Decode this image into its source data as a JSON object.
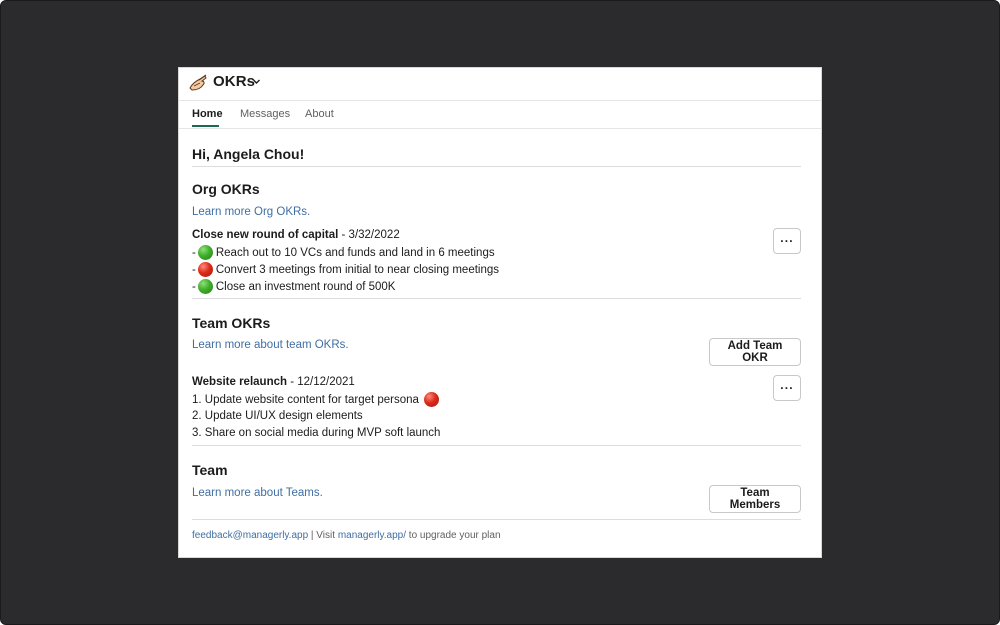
{
  "app": {
    "title": "OKRs",
    "logo_icon": "hand-drawing-icon",
    "caret_icon": "chevron-down-icon"
  },
  "tabs": [
    {
      "label": "Home",
      "active": true
    },
    {
      "label": "Messages",
      "active": false
    },
    {
      "label": "About",
      "active": false
    }
  ],
  "greeting": "Hi, Angela Chou!",
  "org": {
    "title": "Org OKRs",
    "link": "Learn more Org OKRs.",
    "okr": {
      "name": "Close new round of capital",
      "date": " - 3/32/2022",
      "items": [
        {
          "prefix": "- ",
          "status": "green",
          "text": " Reach out to 10 VCs and funds and land in 6 meetings"
        },
        {
          "prefix": "- ",
          "status": "red",
          "text": "Convert 3 meetings from initial to near closing meetings"
        },
        {
          "prefix": "- ",
          "status": "green",
          "text": "Close an investment round of 500K"
        }
      ],
      "more_label": "···"
    }
  },
  "team_okrs": {
    "title": "Team OKRs",
    "link": "Learn more about team OKRs.",
    "add_button": "Add Team OKR",
    "okr": {
      "name": "Website relaunch",
      "date": " - 12/12/2021",
      "items": [
        {
          "text": "1. Update website content for target persona",
          "status": "red"
        },
        {
          "text": "2. Update UI/UX design elements",
          "status": ""
        },
        {
          "text": "3. Share on social media during MVP soft launch",
          "status": ""
        }
      ],
      "more_label": "···"
    }
  },
  "team": {
    "title": "Team",
    "link": "Learn more about Teams.",
    "members_button": "Team Members"
  },
  "footer": {
    "email": "feedback@managerly.app",
    "sep": " | Visit ",
    "site": "managerly.app/",
    "suffix": "  to upgrade your plan"
  },
  "colors": {
    "link": "#3f6fa3",
    "accent": "#1d6b4f",
    "green": "#3fae2a",
    "red": "#dc2a1a",
    "backdrop": "#2b2b2e"
  }
}
